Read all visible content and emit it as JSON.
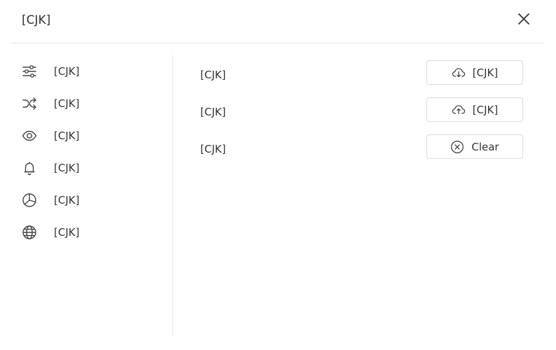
{
  "dialog": {
    "title": "[CJK]"
  },
  "header": {
    "close_icon": "close-icon"
  },
  "sidebar": {
    "items": [
      {
        "label": "[CJK]",
        "icon": "sliders-icon"
      },
      {
        "label": "[CJK]",
        "icon": "shuffle-icon"
      },
      {
        "label": "[CJK]",
        "icon": "eye-icon"
      },
      {
        "label": "[CJK]",
        "icon": "bell-icon"
      },
      {
        "label": "[CJK]",
        "icon": "pie-chart-icon"
      },
      {
        "label": "[CJK]",
        "icon": "globe-icon"
      }
    ]
  },
  "data_panel": {
    "rows": [
      {
        "label": "[CJK]",
        "button_label": "[CJK]",
        "button_icon": "cloud-download-icon"
      },
      {
        "label": "[CJK]",
        "button_label": "[CJK]",
        "button_icon": "cloud-upload-icon"
      },
      {
        "label": "[CJK]",
        "button_label": "Clear",
        "button_icon": "close-circle-icon"
      }
    ]
  }
}
